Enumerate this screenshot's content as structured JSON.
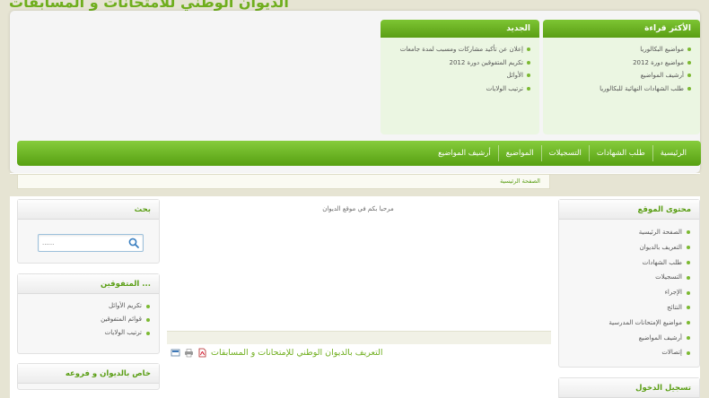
{
  "site": {
    "title": "الديوان الوطني للامتحانات و المسابقات"
  },
  "most_read": {
    "title": "الأكثر قراءة",
    "items": [
      "مواضيع البكالوريا",
      "مواضيع دورة 2012",
      "أرشيف المواضيع",
      "طلب الشهادات النهائية للبكالوريا"
    ]
  },
  "news": {
    "title": "الجديد",
    "items": [
      "إعلان عن تأكيد مشاركات ومسبب لمدة جامعات",
      "تكريم المتفوقين دورة 2012",
      "الأوائل",
      "ترتيب الولايات"
    ]
  },
  "nav": {
    "items": [
      "الرئيسية",
      "طلب الشهادات",
      "التسجيلات",
      "المواضيع",
      "أرشيف المواضيع"
    ]
  },
  "breadcrumb": {
    "text": "الصفحة الرئيسية"
  },
  "main_menu": {
    "title": "محتوى الموقع",
    "items": [
      "الصفحة الرئيسية",
      "التعريف بالديوان",
      "طلب الشهادات",
      "التسجيلات",
      "الإجراء",
      "النتائج",
      "مواضيع الإمتحانات المدرسية",
      "أرشيف المواضيع",
      "إتصالات"
    ]
  },
  "login": {
    "title": "تسجيل الدخول"
  },
  "search": {
    "title": "بحث",
    "placeholder": "......",
    "icon": "search-icon"
  },
  "top_students": {
    "title": "... المتفوقين",
    "items": [
      "تكريم الأوائل",
      "قوائم المتفوقين",
      "ترتيب الولايات"
    ]
  },
  "about": {
    "title": "خاص بالديوان و فروعه"
  },
  "content": {
    "welcome": "مرحبا بكم في موقع الديوان",
    "article_title": "التعريف بالديوان الوطني للإمتحانات و المسابقات",
    "tool_icons": [
      "email-icon",
      "print-icon",
      "pdf-icon"
    ]
  },
  "colors": {
    "accent": "#6fae1d",
    "nav_top": "#86cc3c",
    "nav_bottom": "#57a012",
    "box_bg": "#ebf6e2",
    "page_bg": "#e6e4d3"
  }
}
